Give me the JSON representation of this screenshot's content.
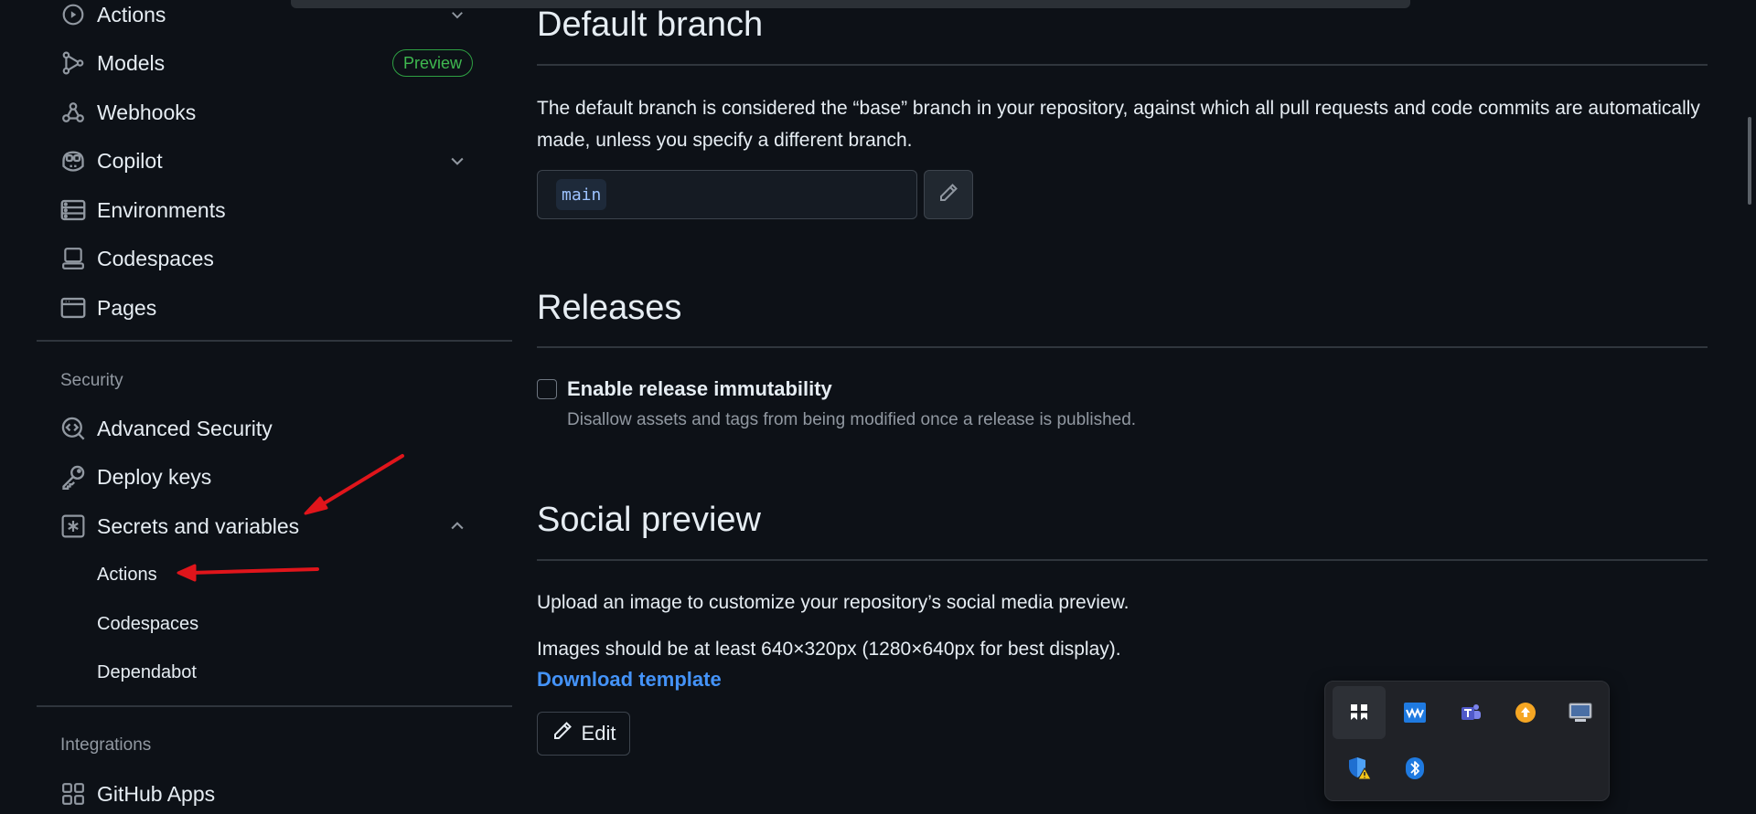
{
  "sidebar": {
    "items": [
      {
        "label": "Actions",
        "icon": "play-icon"
      },
      {
        "label": "Models",
        "icon": "models-icon",
        "badge": "Preview"
      },
      {
        "label": "Webhooks",
        "icon": "webhook-icon"
      },
      {
        "label": "Copilot",
        "icon": "copilot-icon"
      },
      {
        "label": "Environments",
        "icon": "server-icon"
      },
      {
        "label": "Codespaces",
        "icon": "codespaces-icon"
      },
      {
        "label": "Pages",
        "icon": "browser-icon"
      }
    ],
    "security_label": "Security",
    "security_items": [
      {
        "label": "Advanced Security",
        "icon": "codescan-icon"
      },
      {
        "label": "Deploy keys",
        "icon": "key-icon"
      },
      {
        "label": "Secrets and variables",
        "icon": "asterisk-icon"
      }
    ],
    "secrets_sub": [
      "Actions",
      "Codespaces",
      "Dependabot"
    ],
    "integrations_label": "Integrations",
    "integrations_items": [
      {
        "label": "GitHub Apps",
        "icon": "apps-icon"
      }
    ]
  },
  "main": {
    "default_branch": {
      "title": "Default branch",
      "description": "The default branch is considered the “base” branch in your repository, against which all pull requests and code commits are automatically made, unless you specify a different branch.",
      "branch": "main"
    },
    "releases": {
      "title": "Releases",
      "checkbox_label": "Enable release immutability",
      "checkbox_desc": "Disallow assets and tags from being modified once a release is published.",
      "checked": false
    },
    "social_preview": {
      "title": "Social preview",
      "line1": "Upload an image to customize your repository’s social media preview.",
      "line2": "Images should be at least 640×320px (1280×640px for best display).",
      "link": "Download template",
      "edit_label": "Edit"
    }
  },
  "tray": {
    "icons": [
      "bookmark-app-icon",
      "waves-app-icon",
      "teams-icon",
      "update-icon",
      "display-icon",
      "security-warning-icon",
      "bluetooth-icon"
    ]
  },
  "colors": {
    "background": "#0d1117",
    "text": "#e6edf3",
    "muted": "#9198a1",
    "link": "#4493f8",
    "badge_green": "#3fb950",
    "annotation_red": "#e0151b"
  }
}
